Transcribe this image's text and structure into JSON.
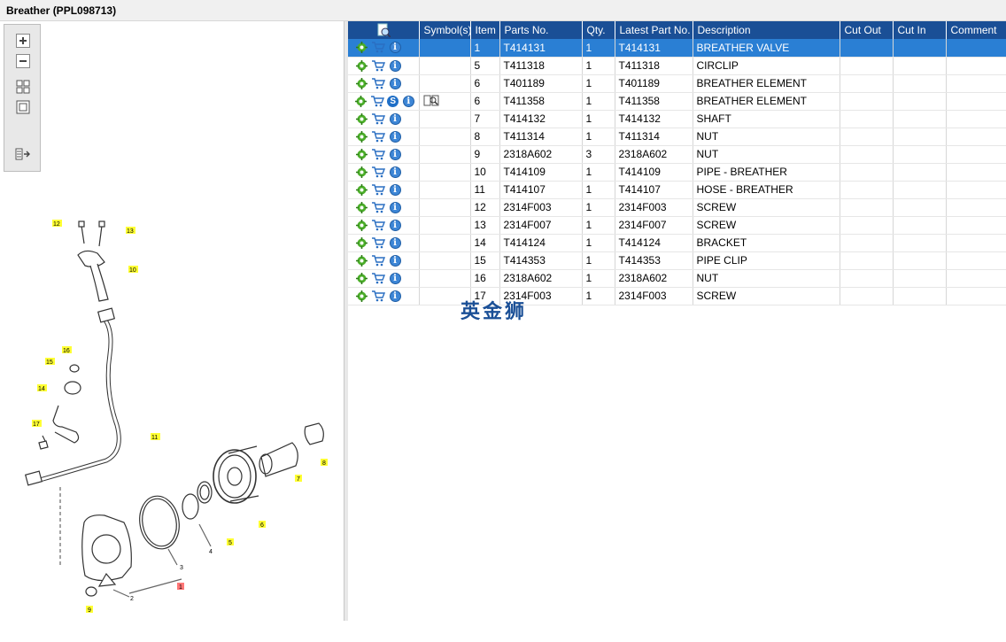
{
  "window": {
    "title": "Breather (PPL098713)"
  },
  "toolbar": {
    "zoom_in": "zoom-in-icon",
    "zoom_out": "zoom-out-icon",
    "fit": "fit-grid-icon",
    "actual": "actual-size-icon",
    "toggle": "toggle-panel-icon"
  },
  "table": {
    "headers": [
      "",
      "Symbol(s)",
      "Item",
      "Parts No.",
      "Qty.",
      "Latest Part No.",
      "Description",
      "Cut Out",
      "Cut In",
      "Comment"
    ],
    "rows": [
      {
        "item": "1",
        "part": "T414131",
        "qty": "1",
        "latest": "T414131",
        "desc": "BREATHER VALVE",
        "symbol": ""
      },
      {
        "item": "5",
        "part": "T411318",
        "qty": "1",
        "latest": "T411318",
        "desc": "CIRCLIP",
        "symbol": ""
      },
      {
        "item": "6",
        "part": "T401189",
        "qty": "1",
        "latest": "T401189",
        "desc": "BREATHER ELEMENT",
        "symbol": ""
      },
      {
        "item": "6",
        "part": "T411358",
        "qty": "1",
        "latest": "T411358",
        "desc": "BREATHER ELEMENT",
        "symbol": "book"
      },
      {
        "item": "7",
        "part": "T414132",
        "qty": "1",
        "latest": "T414132",
        "desc": "SHAFT",
        "symbol": ""
      },
      {
        "item": "8",
        "part": "T411314",
        "qty": "1",
        "latest": "T411314",
        "desc": "NUT",
        "symbol": ""
      },
      {
        "item": "9",
        "part": "2318A602",
        "qty": "3",
        "latest": "2318A602",
        "desc": "NUT",
        "symbol": ""
      },
      {
        "item": "10",
        "part": "T414109",
        "qty": "1",
        "latest": "T414109",
        "desc": "PIPE - BREATHER",
        "symbol": ""
      },
      {
        "item": "11",
        "part": "T414107",
        "qty": "1",
        "latest": "T414107",
        "desc": "HOSE - BREATHER",
        "symbol": ""
      },
      {
        "item": "12",
        "part": "2314F003",
        "qty": "1",
        "latest": "2314F003",
        "desc": "SCREW",
        "symbol": ""
      },
      {
        "item": "13",
        "part": "2314F007",
        "qty": "1",
        "latest": "2314F007",
        "desc": "SCREW",
        "symbol": ""
      },
      {
        "item": "14",
        "part": "T414124",
        "qty": "1",
        "latest": "T414124",
        "desc": "BRACKET",
        "symbol": ""
      },
      {
        "item": "15",
        "part": "T414353",
        "qty": "1",
        "latest": "T414353",
        "desc": "PIPE CLIP",
        "symbol": ""
      },
      {
        "item": "16",
        "part": "2318A602",
        "qty": "1",
        "latest": "2318A602",
        "desc": "NUT",
        "symbol": ""
      },
      {
        "item": "17",
        "part": "2314F003",
        "qty": "1",
        "latest": "2314F003",
        "desc": "SCREW",
        "symbol": ""
      }
    ]
  },
  "watermark": "英金狮",
  "diagram": {
    "callouts": [
      "12",
      "13",
      "10",
      "16",
      "15",
      "14",
      "17",
      "11",
      "8",
      "7",
      "6",
      "5",
      "4",
      "3",
      "1",
      "2",
      "9"
    ]
  },
  "colors": {
    "header": "#1a4f96",
    "selected": "#2a7fd4",
    "callout": "#ffff33",
    "callout_red": "#ff7777"
  }
}
